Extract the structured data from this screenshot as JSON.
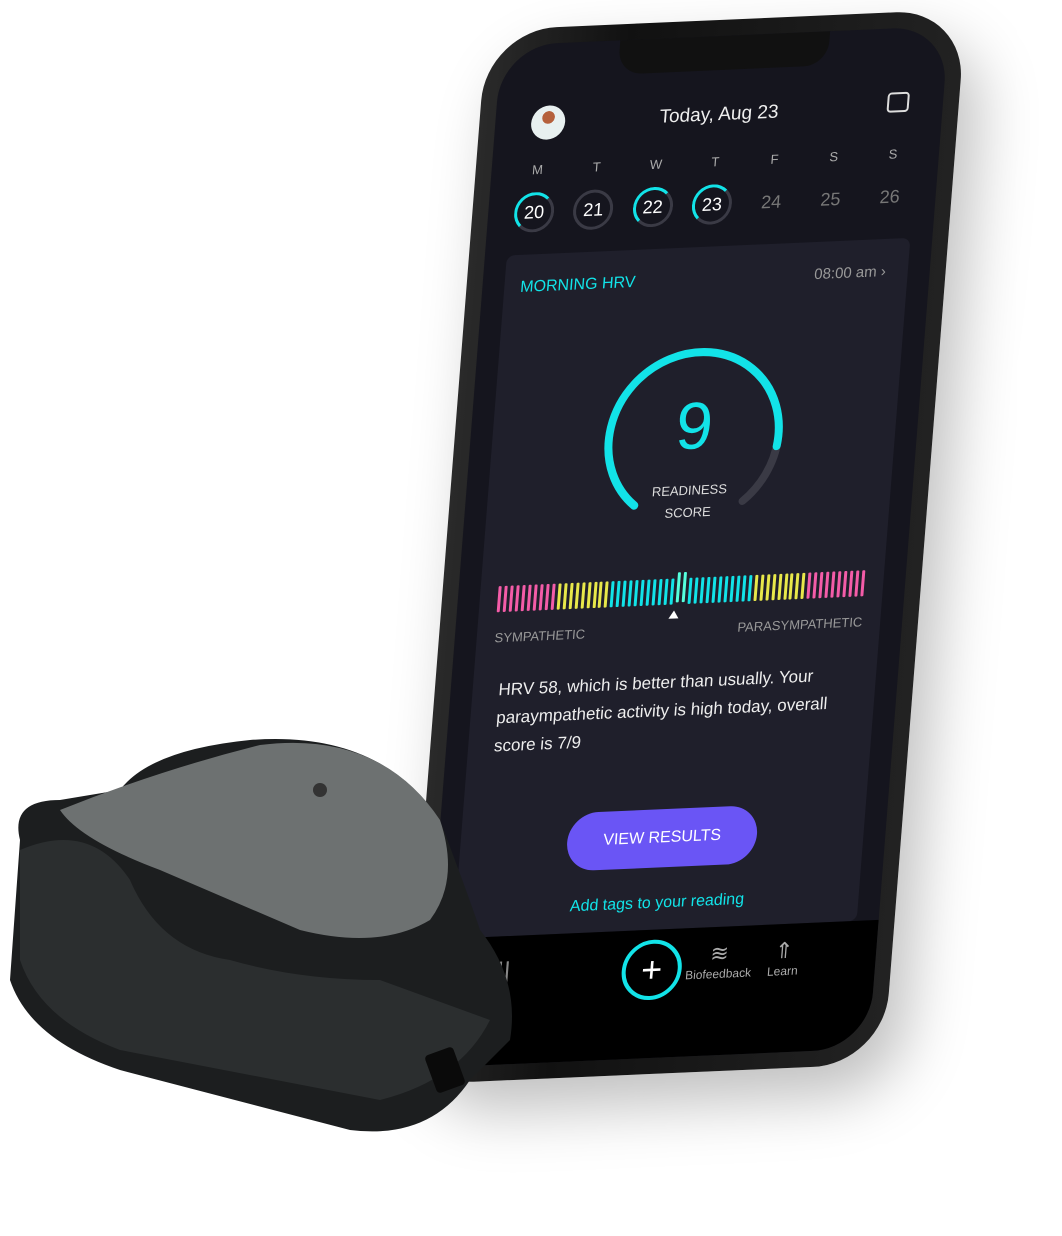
{
  "header": {
    "title": "Today, Aug 23",
    "avatar_icon": "user-avatar",
    "calendar_icon": "calendar-icon"
  },
  "week": [
    {
      "label": "M",
      "day": "20",
      "state": "on"
    },
    {
      "label": "T",
      "day": "21",
      "state": "empty"
    },
    {
      "label": "W",
      "day": "22",
      "state": "on"
    },
    {
      "label": "T",
      "day": "23",
      "state": "on"
    },
    {
      "label": "F",
      "day": "24",
      "state": "off"
    },
    {
      "label": "S",
      "day": "25",
      "state": "off"
    },
    {
      "label": "S",
      "day": "26",
      "state": "off"
    }
  ],
  "card": {
    "title": "MORNING HRV",
    "time": "08:00 am",
    "chevron": "›",
    "score": "9",
    "score_label_1": "READINESS",
    "score_label_2": "SCORE",
    "gauge_fraction": 0.85,
    "balance_position": 0.48,
    "left_label": "SYMPATHETIC",
    "right_label": "PARASYMPATHETIC",
    "description": "HRV 58, which is better than usually. Your paraympathetic activity is high today, overall score is 7/9",
    "button": "VIEW RESULTS",
    "link": "Add tags to your reading"
  },
  "tabs": {
    "plus": "+",
    "biofeedback": "Biofeedback",
    "learn": "Learn",
    "stats_icon": "bar-chart-icon",
    "wind_icon": "wind-icon",
    "rocket_icon": "rocket-icon"
  },
  "colors": {
    "accent": "#12e3e8",
    "button": "#6a55f5",
    "pink": "#f45ca8",
    "yellow": "#e8e84a",
    "background": "#15151e"
  }
}
